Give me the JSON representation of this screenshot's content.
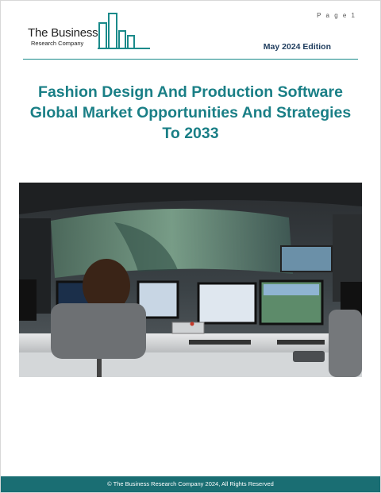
{
  "header": {
    "page_label": "P a g e  1",
    "logo_line1": "The Business",
    "logo_line2": "Research Company",
    "edition": "May 2024 Edition"
  },
  "report": {
    "title_lines": [
      "Fashion Design And Production Software",
      "Global Market Opportunities And Strategies",
      "To 2033"
    ]
  },
  "cover_image": {
    "subject": "control-room-operator-photo"
  },
  "footer": {
    "copyright": "© The Business Research Company 2024, All Rights Reserved"
  },
  "colors": {
    "brand_teal": "#1a7f86",
    "footer_teal": "#1a6e73",
    "edition_navy": "#1f3d5e"
  }
}
